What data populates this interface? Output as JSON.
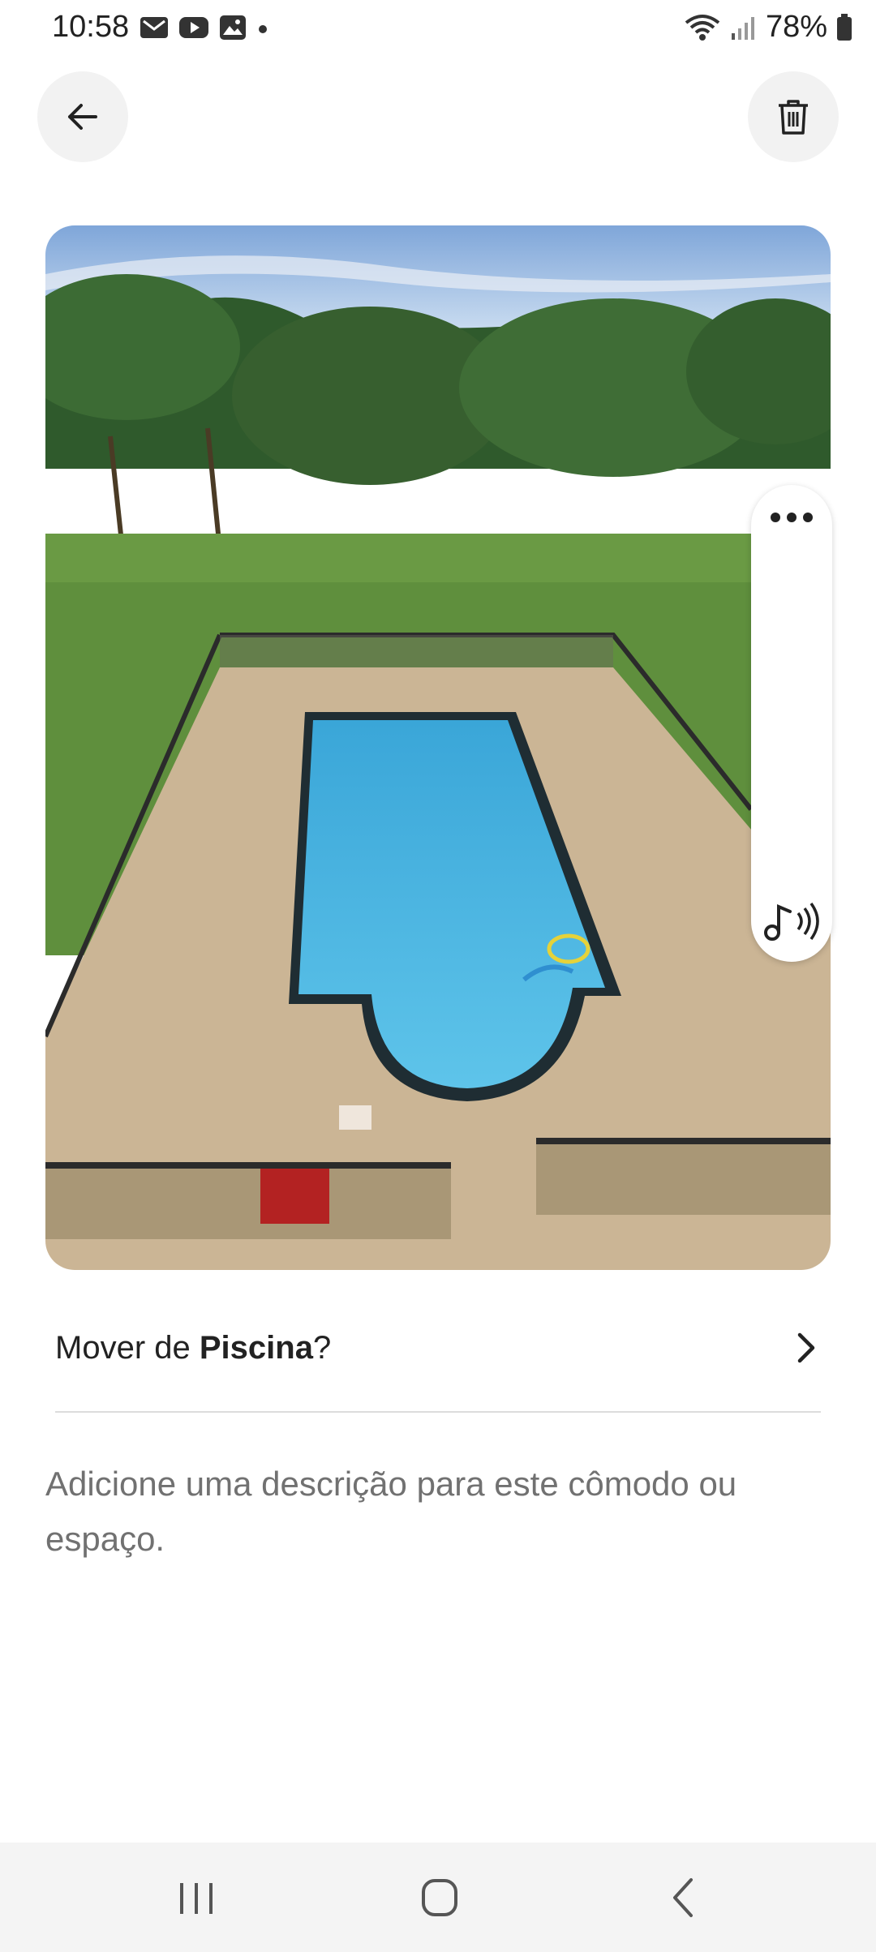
{
  "status_bar": {
    "time": "10:58",
    "battery_percent": "78%",
    "notification_icons": [
      "gmail-icon",
      "youtube-icon",
      "gallery-icon",
      "dot-icon"
    ],
    "system_icons": [
      "wifi-icon",
      "signal-icon",
      "battery-icon"
    ]
  },
  "header": {
    "back_icon": "arrow-left-icon",
    "delete_icon": "trash-icon"
  },
  "photo": {
    "side_menu_icon": "more-horizontal-icon",
    "audio_icon": "music-sound-icon"
  },
  "move": {
    "prefix": "Mover de ",
    "room": "Piscina",
    "suffix": "?",
    "chevron_icon": "chevron-right-icon"
  },
  "description_placeholder": "Adicione uma descrição para este cômodo ou espaço.",
  "nav_bar": {
    "icons": [
      "recent-apps-icon",
      "home-icon",
      "back-icon"
    ]
  }
}
